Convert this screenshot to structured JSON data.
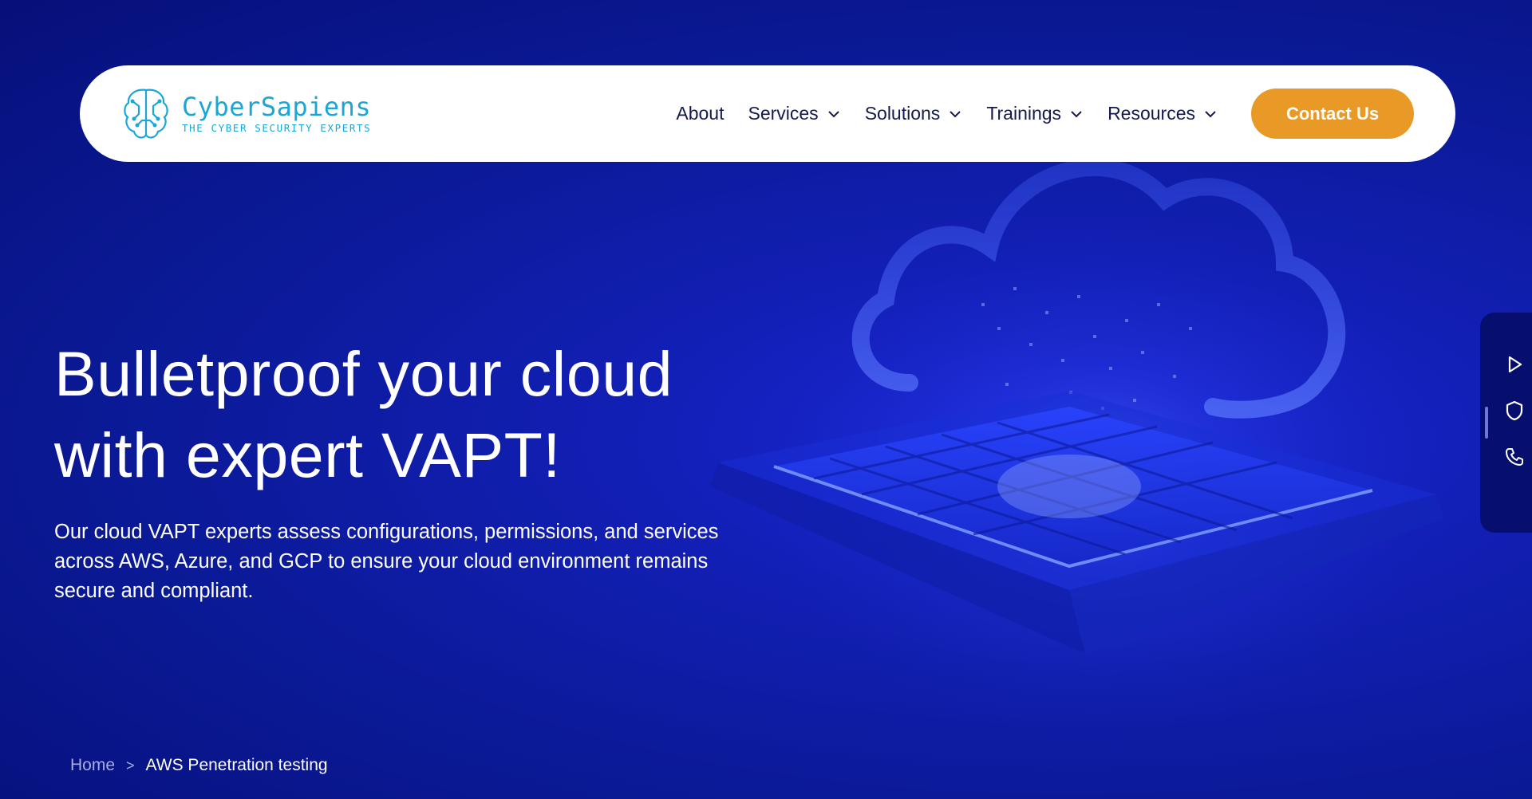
{
  "brand": {
    "name": "CyberSapiens",
    "tagline": "THE CYBER SECURITY EXPERTS"
  },
  "nav": {
    "items": [
      {
        "label": "About",
        "has_dropdown": false
      },
      {
        "label": "Services",
        "has_dropdown": true
      },
      {
        "label": "Solutions",
        "has_dropdown": true
      },
      {
        "label": "Trainings",
        "has_dropdown": true
      },
      {
        "label": "Resources",
        "has_dropdown": true
      }
    ],
    "cta_label": "Contact Us"
  },
  "hero": {
    "title_line1": "Bulletproof your cloud",
    "title_line2": "with expert VAPT!",
    "description": "Our cloud VAPT experts assess configurations, permissions, and services across AWS, Azure, and GCP to ensure your cloud environment remains secure and compliant."
  },
  "breadcrumb": {
    "home": "Home",
    "separator": ">",
    "current": "AWS Penetration testing"
  },
  "side_bar": {
    "icons": [
      "play-icon",
      "shield-icon",
      "phone-icon"
    ]
  },
  "colors": {
    "background": "#0b1a98",
    "accent": "#e99a26",
    "brand": "#1aa6d6",
    "nav_text": "#151a4c"
  }
}
